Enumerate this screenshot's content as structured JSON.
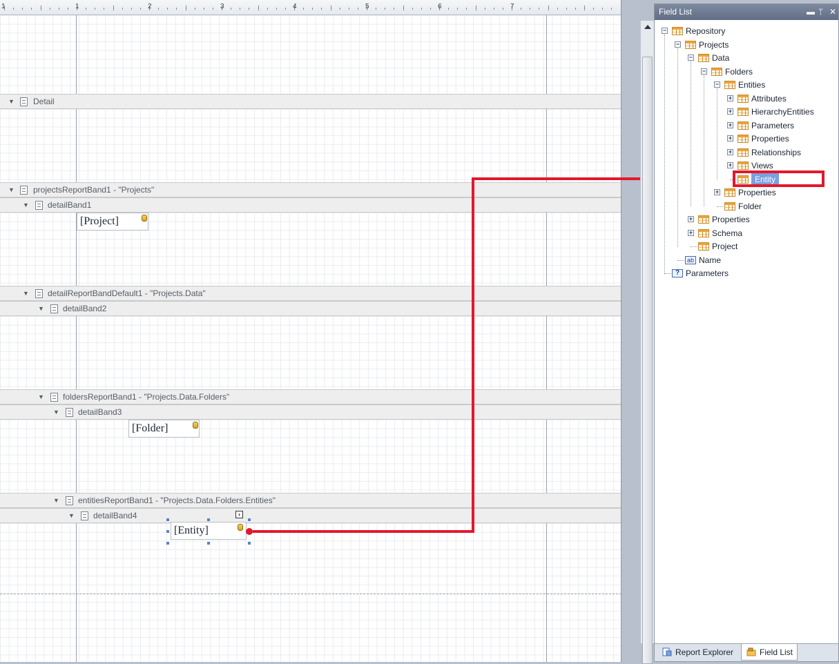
{
  "ruler": {
    "numbers": [
      "1",
      "2",
      "3",
      "4",
      "5",
      "6",
      "7"
    ],
    "origin": "1"
  },
  "bands": [
    {
      "label": "Detail",
      "level": 0
    },
    {
      "label": "projectsReportBand1 - \"Projects\"",
      "level": 0
    },
    {
      "label": "detailBand1",
      "level": 1
    },
    {
      "label": "detailReportBandDefault1 - \"Projects.Data\"",
      "level": 1
    },
    {
      "label": "detailBand2",
      "level": 2
    },
    {
      "label": "foldersReportBand1 - \"Projects.Data.Folders\"",
      "level": 2
    },
    {
      "label": "detailBand3",
      "level": 3
    },
    {
      "label": "entitiesReportBand1 - \"Projects.Data.Folders.Entities\"",
      "level": 3
    },
    {
      "label": "detailBand4",
      "level": 4
    }
  ],
  "fields": {
    "project": "[Project]",
    "folder": "[Folder]",
    "entity": "[Entity]"
  },
  "field_list": {
    "title": "Field List",
    "tree": [
      {
        "label": "Repository",
        "icon": "table-icon",
        "expander": "−"
      },
      {
        "label": "Projects",
        "icon": "table-icon",
        "expander": "−"
      },
      {
        "label": "Data",
        "icon": "table-icon",
        "expander": "−"
      },
      {
        "label": "Folders",
        "icon": "table-icon",
        "expander": "−"
      },
      {
        "label": "Entities",
        "icon": "table-icon",
        "expander": "−"
      },
      {
        "label": "Attributes",
        "icon": "table-icon",
        "expander": "+"
      },
      {
        "label": "HierarchyEntities",
        "icon": "table-icon",
        "expander": "+"
      },
      {
        "label": "Parameters",
        "icon": "table-icon",
        "expander": "+"
      },
      {
        "label": "Properties",
        "icon": "table-icon",
        "expander": "+"
      },
      {
        "label": "Relationships",
        "icon": "table-icon",
        "expander": "+"
      },
      {
        "label": "Views",
        "icon": "table-icon",
        "expander": "+"
      },
      {
        "label": "Entity",
        "icon": "table-icon",
        "expander": ""
      },
      {
        "label": "Properties",
        "icon": "table-icon",
        "expander": "+"
      },
      {
        "label": "Folder",
        "icon": "table-icon",
        "expander": ""
      },
      {
        "label": "Properties",
        "icon": "table-icon",
        "expander": "+"
      },
      {
        "label": "Schema",
        "icon": "table-icon",
        "expander": "+"
      },
      {
        "label": "Project",
        "icon": "table-icon",
        "expander": ""
      },
      {
        "label": "Name",
        "icon": "text-field-icon",
        "expander": ""
      },
      {
        "label": "Parameters",
        "icon": "parameter-icon",
        "expander": ""
      }
    ],
    "tabs": {
      "report_explorer": "Report Explorer",
      "field_list": "Field List"
    },
    "title_buttons": {
      "minimize": "▬",
      "pin": "ᛘ",
      "close": "✕"
    },
    "icon_text": {
      "abc": "ab",
      "question": "?"
    }
  },
  "colors": {
    "highlight": "#e3182d",
    "selection": "#7aa0de",
    "title_bar": "#6b788e"
  }
}
